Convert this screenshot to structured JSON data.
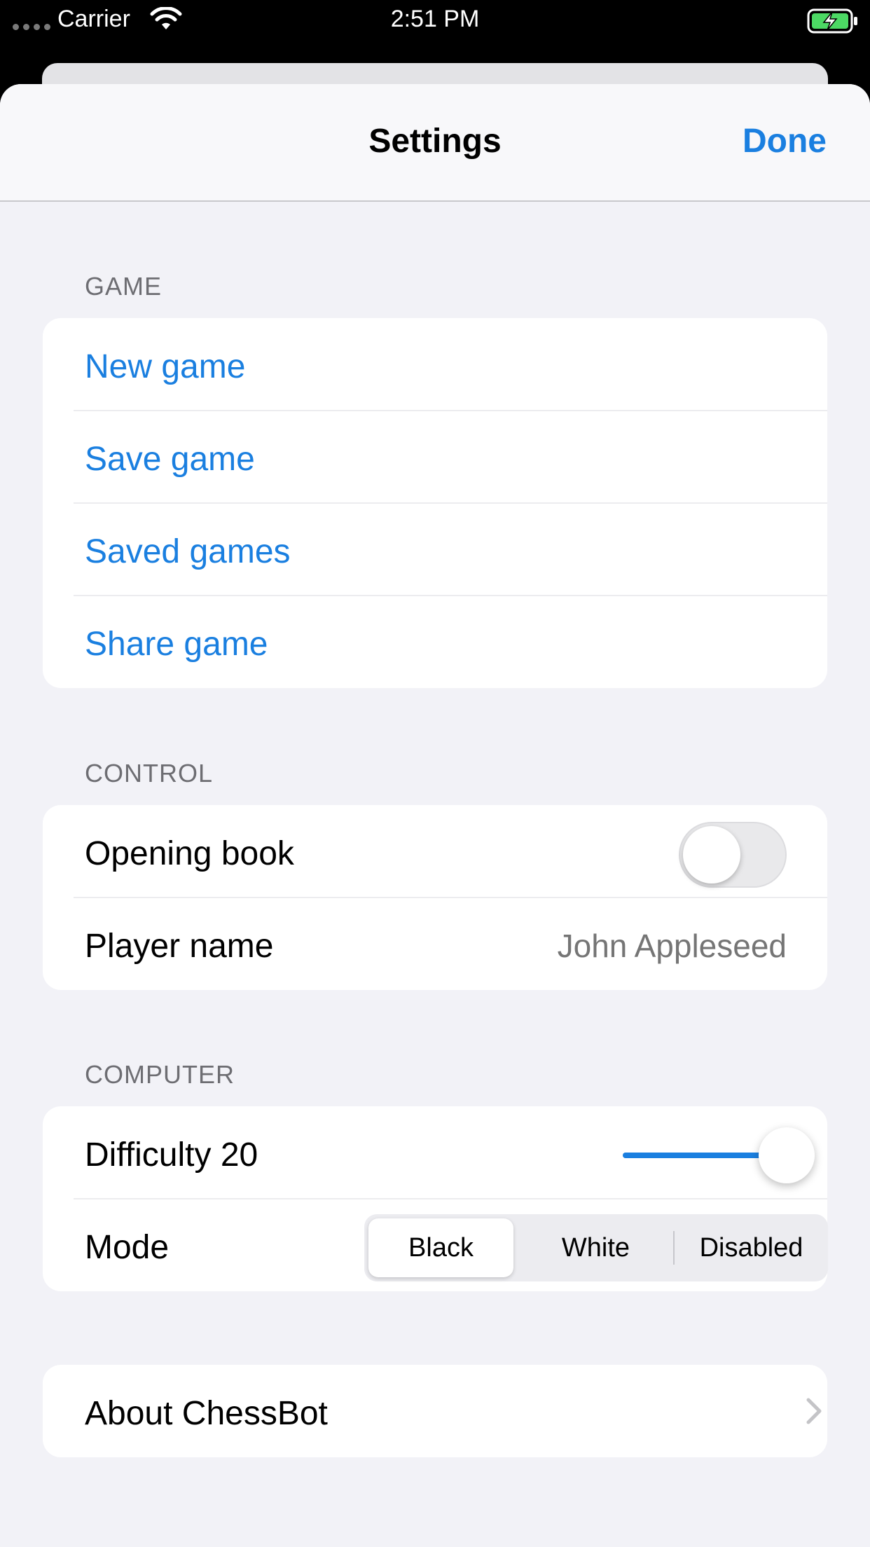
{
  "status_bar": {
    "carrier": "Carrier",
    "time": "2:51 PM",
    "icons": [
      "signal-dots-icon",
      "wifi-icon",
      "battery-charging-icon"
    ],
    "battery_color": "#4cd964"
  },
  "nav": {
    "title": "Settings",
    "done_label": "Done"
  },
  "sections": {
    "game": {
      "header": "GAME",
      "items": [
        {
          "label": "New game"
        },
        {
          "label": "Save game"
        },
        {
          "label": "Saved games"
        },
        {
          "label": "Share game"
        }
      ]
    },
    "control": {
      "header": "CONTROL",
      "opening_book_label": "Opening book",
      "opening_book_enabled": false,
      "player_name_label": "Player name",
      "player_name_placeholder": "John Appleseed",
      "player_name_value": ""
    },
    "computer": {
      "header": "COMPUTER",
      "difficulty_label": "Difficulty 20",
      "difficulty_fraction": 1.0,
      "mode_label": "Mode",
      "mode_options": [
        "Black",
        "White",
        "Disabled"
      ],
      "mode_selected": "Black"
    },
    "about": {
      "label": "About ChessBot"
    }
  },
  "colors": {
    "accent": "#1a7fe0",
    "background": "#f2f2f7",
    "cell": "#ffffff",
    "secondary_text": "#6d6d72",
    "placeholder": "#c4c4c7"
  }
}
